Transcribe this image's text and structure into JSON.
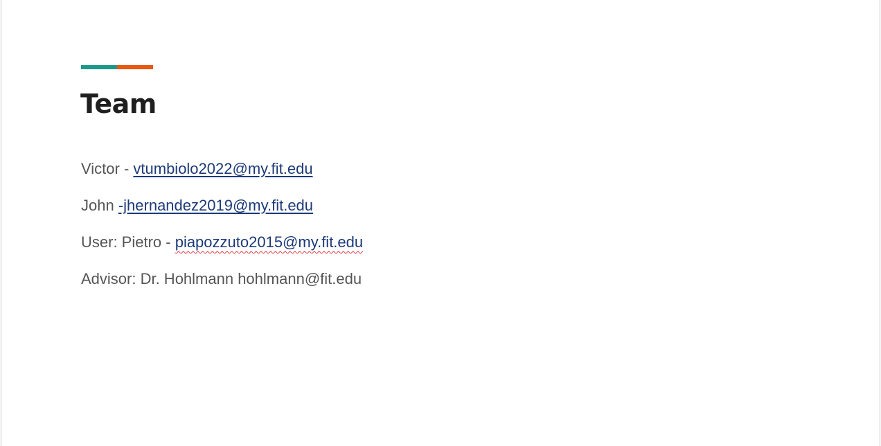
{
  "slide": {
    "title": "Team",
    "accent_colors": {
      "teal": "#1b9a8a",
      "orange": "#e8580f"
    },
    "members": [
      {
        "label": "Victor - ",
        "email": "vtumbiolo2022@my.fit.edu"
      },
      {
        "label": "John ",
        "email": "-jhernandez2019@my.fit.edu"
      },
      {
        "label": "User: Pietro - ",
        "email": "piapozzuto2015@my.fit.edu"
      },
      {
        "label": "Advisor: Dr. Hohlmann hohlmann@fit.edu"
      }
    ]
  }
}
